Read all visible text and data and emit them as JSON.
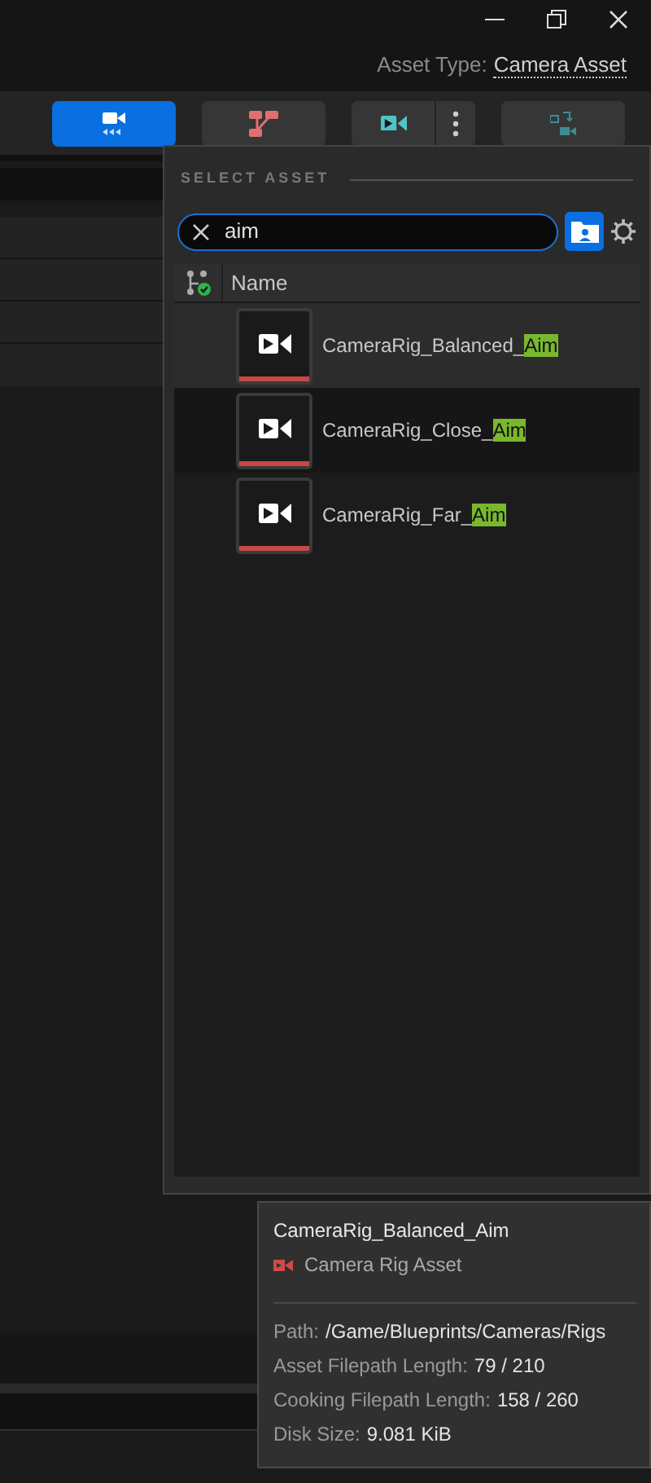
{
  "asset_type": {
    "label": "Asset Type:",
    "value": "Camera Asset"
  },
  "toolbar": [
    {
      "kind": "camera-rig",
      "selected": true
    },
    {
      "kind": "node-graph",
      "selected": false
    },
    {
      "kind": "camera",
      "selected": false,
      "has_menu": true
    },
    {
      "kind": "swap",
      "selected": false
    }
  ],
  "picker": {
    "title": "SELECT ASSET",
    "search": {
      "value": "aim"
    },
    "column": "Name",
    "rows": [
      {
        "prefix": "CameraRig_Balanced_",
        "match": "Aim",
        "hovered": true
      },
      {
        "prefix": "CameraRig_Close_",
        "match": "Aim",
        "hovered": false
      },
      {
        "prefix": "CameraRig_Far_",
        "match": "Aim",
        "hovered": false
      }
    ]
  },
  "tooltip": {
    "title": "CameraRig_Balanced_Aim",
    "type": "Camera Rig Asset",
    "details": [
      {
        "label": "Path:",
        "value": "/Game/Blueprints/Cameras/Rigs"
      },
      {
        "label": "Asset Filepath Length:",
        "value": "79 / 210"
      },
      {
        "label": "Cooking Filepath Length:",
        "value": "158 / 260"
      },
      {
        "label": "Disk Size:",
        "value": "9.081 KiB"
      }
    ]
  }
}
